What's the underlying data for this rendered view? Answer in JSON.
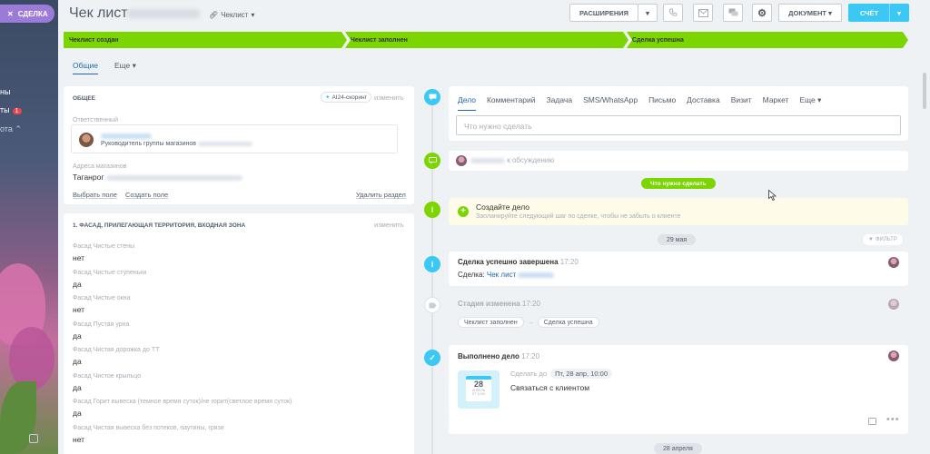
{
  "sidebar": {
    "deal_label": "СДЕЛКА",
    "items": [
      {
        "label": "ны"
      },
      {
        "label": "ты",
        "badge": "1"
      },
      {
        "label": "ота"
      }
    ]
  },
  "header": {
    "title": "Чек лист",
    "category": "Чеклист",
    "ext_label": "РАСШИРЕНИЯ",
    "doc_label": "ДОКУМЕНТ",
    "invoice_label": "СЧЁТ"
  },
  "stages": [
    {
      "label": "Чеклист создан"
    },
    {
      "label": "Чеклист заполнен"
    },
    {
      "label": "Сделка успешна"
    }
  ],
  "top_tabs": [
    {
      "label": "Общие"
    },
    {
      "label": "Еще"
    }
  ],
  "general": {
    "heading": "ОБЩЕЕ",
    "ai_label": "AI24-скоринг",
    "edit_label": "изменить",
    "responsible_label": "Ответственный",
    "responsible_role": "Руководитель группы магазинов",
    "address_label": "Адреса магазинов",
    "address_value": "Таганрог",
    "select_field": "Выбрать поле",
    "create_field": "Создать поле",
    "delete_section": "Удалить раздел"
  },
  "section1": {
    "heading": "1. ФАСАД, ПРИЛЕГАЮЩАЯ ТЕРРИТОРИЯ, ВХОДНАЯ ЗОНА",
    "edit_label": "изменить",
    "fields": [
      {
        "label": "Фасад Чистые стены",
        "value": "нет"
      },
      {
        "label": "Фасад Чистые ступеньки",
        "value": "да"
      },
      {
        "label": "Фасад Чистые окна",
        "value": "нет"
      },
      {
        "label": "Фасад Пустая урна",
        "value": "да"
      },
      {
        "label": "Фасад Чистая дорожка до ТТ",
        "value": "да"
      },
      {
        "label": "Фасад Чистое крыльцо",
        "value": "да"
      },
      {
        "label": "Фасад Горит вывеска (темное время суток)/не горит(светлое время суток)",
        "value": "да"
      },
      {
        "label": "Фасад Чистая вывеска без потеков, паутины, грязи",
        "value": "нет"
      }
    ]
  },
  "activity": {
    "tabs": [
      {
        "label": "Дело"
      },
      {
        "label": "Комментарий"
      },
      {
        "label": "Задача"
      },
      {
        "label": "SMS/WhatsApp"
      },
      {
        "label": "Письмо"
      },
      {
        "label": "Доставка"
      },
      {
        "label": "Визит"
      },
      {
        "label": "Маркет"
      },
      {
        "label": "Еще"
      }
    ],
    "placeholder": "Что нужно сделать"
  },
  "timeline": {
    "discussion_text": "к обсуждению",
    "todo_pill": "Что нужно сделать",
    "create_title": "Создайте дело",
    "create_sub": "Запланируйте следующий шаг по сделке, чтобы не забыть о клиенте",
    "date1": "29 мая",
    "filter_label": "ФИЛЬТР",
    "done_title": "Сделка успешно завершена",
    "done_time": "17:20",
    "done_deal_label": "Сделка:",
    "done_deal_link": "Чек лист",
    "stage_title": "Стадия изменена",
    "stage_time": "17:20",
    "stage_from": "Чеклист заполнен",
    "stage_to": "Сделка успешна",
    "task_title": "Выполнено дело",
    "task_time": "17:20",
    "task_deadline_label": "Сделать до",
    "task_deadline": "Пт, 28 апр, 10:00",
    "task_text": "Связаться с клиентом",
    "cal_day": "28",
    "cal_month": "АПРЕЛЬ",
    "cal_time": "ПТ 10:00",
    "date2": "28 апреля"
  },
  "colors": {
    "accent": "#3bc8f5",
    "stage_green": "#7bd500",
    "link_blue": "#2067b0"
  }
}
